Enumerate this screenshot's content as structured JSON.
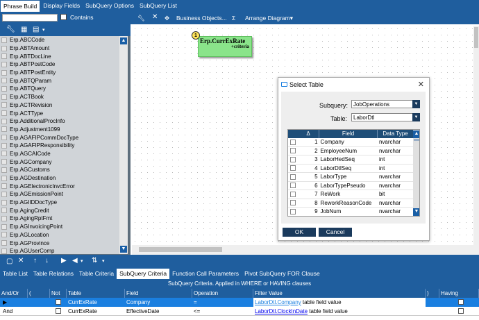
{
  "top_tabs": [
    "Phrase Build",
    "Display Fields",
    "SubQuery Options",
    "SubQuery List"
  ],
  "left": {
    "contains_label": "Contains",
    "tables": [
      "Erp.ABCCode",
      "Erp.ABTAmount",
      "Erp.ABTDocLine",
      "Erp.ABTPostCode",
      "Erp.ABTPostEntity",
      "Erp.ABTQParam",
      "Erp.ABTQuery",
      "Erp.ACTBook",
      "Erp.ACTRevision",
      "Erp.ACTType",
      "Erp.AdditionalProcInfo",
      "Erp.Adjustment1099",
      "Erp.AGAFIPCommDocType",
      "Erp.AGAFIPResponsibility",
      "Erp.AGCAICode",
      "Erp.AGCompany",
      "Erp.AGCustoms",
      "Erp.AGDestination",
      "Erp.AGElectronicInvcError",
      "Erp.AGEmissionPoint",
      "Erp.AGIIDDocType",
      "Erp.AgingCredit",
      "Erp.AgingRptFmt",
      "Erp.AGInvoicingPoint",
      "Erp.AGLocation",
      "Erp.AGProvince",
      "Erp.AGUserComp"
    ]
  },
  "right_toolbar": {
    "business_objects": "Business Objects...",
    "sigma": "Σ",
    "arrange": "Arrange Diagram"
  },
  "node": {
    "number": "1",
    "name": "Erp.CurrExRate",
    "sub": "+criteria"
  },
  "dialog": {
    "title": "Select Table",
    "subquery_label": "Subquery:",
    "subquery_value": "JobOperations",
    "table_label": "Table:",
    "table_value": "LaborDtl",
    "col_field": "Field",
    "col_type": "Data Type",
    "rows": [
      {
        "n": "1",
        "field": "Company",
        "type": "nvarchar"
      },
      {
        "n": "2",
        "field": "EmployeeNum",
        "type": "nvarchar"
      },
      {
        "n": "3",
        "field": "LaborHedSeq",
        "type": "int"
      },
      {
        "n": "4",
        "field": "LaborDtlSeq",
        "type": "int"
      },
      {
        "n": "5",
        "field": "LaborType",
        "type": "nvarchar"
      },
      {
        "n": "6",
        "field": "LaborTypePseudo",
        "type": "nvarchar"
      },
      {
        "n": "7",
        "field": "ReWork",
        "type": "bit"
      },
      {
        "n": "8",
        "field": "ReworkReasonCode",
        "type": "nvarchar"
      },
      {
        "n": "9",
        "field": "JobNum",
        "type": "nvarchar"
      }
    ],
    "ok": "OK",
    "cancel": "Cancel"
  },
  "bottom_tabs": [
    "Table List",
    "Table Relations",
    "Table Criteria",
    "SubQuery Criteria",
    "Function Call Parameters",
    "Pivot SubQuery FOR Clause"
  ],
  "criteria_header": "SubQuery Criteria. Applied in WHERE or HAVING clauses",
  "grid_headers": {
    "andor": "And/Or",
    "paren_open": "(",
    "not": "Not",
    "table": "Table",
    "field": "Field",
    "operation": "Operation",
    "filter": "Filter Value",
    "paren_close": ")",
    "having": "Having"
  },
  "grid_rows": [
    {
      "andor": "",
      "table": "CurrExRate",
      "field": "Company",
      "operation": "=",
      "filter_link": "LaborDtl.Company",
      "filter_suffix": " table field value"
    },
    {
      "andor": "And",
      "table": "CurrExRate",
      "field": "EffectiveDate",
      "operation": "<=",
      "filter_link": "LaborDtl.ClockInDate",
      "filter_suffix": " table field value"
    }
  ]
}
